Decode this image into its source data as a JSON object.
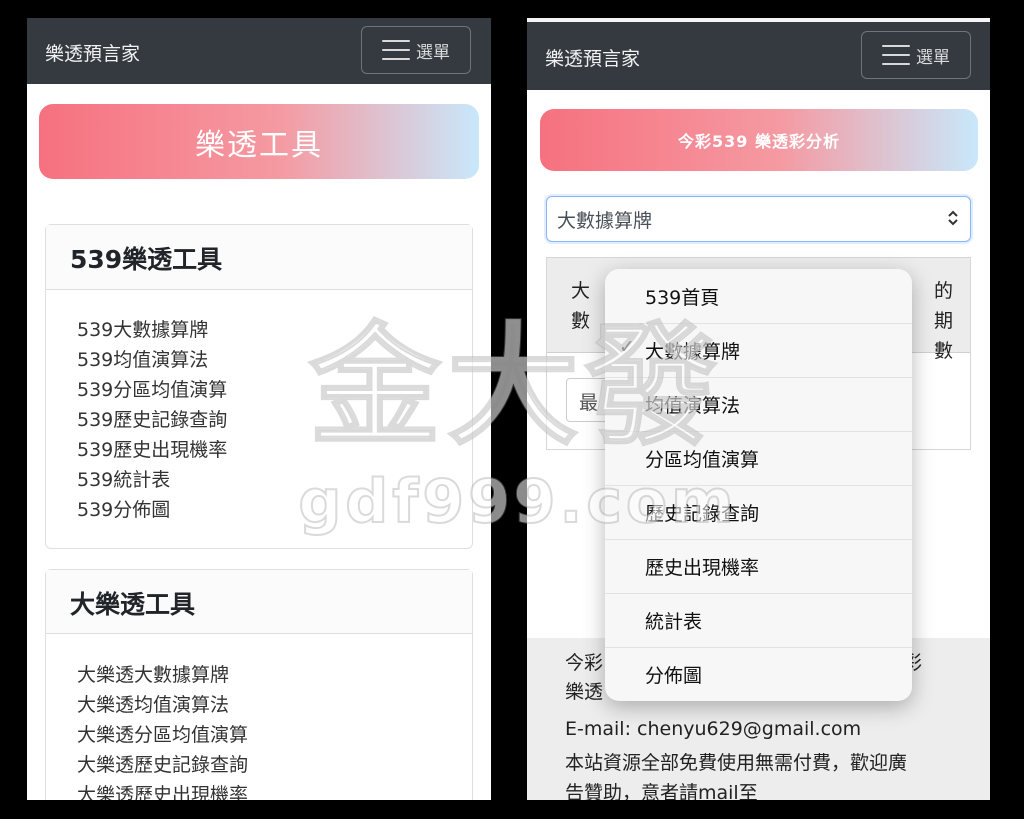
{
  "left": {
    "brand": "樂透預言家",
    "menu_label": "選單",
    "banner_title": "樂透工具",
    "card1": {
      "title": "539樂透工具",
      "links": [
        "539大數據算牌",
        "539均值演算法",
        "539分區均值演算",
        "539歷史記錄查詢",
        "539歷史出現機率",
        "539統計表",
        "539分佈圖"
      ]
    },
    "card2": {
      "title": "大樂透工具",
      "links": [
        "大樂透大數據算牌",
        "大樂透均值演算法",
        "大樂透分區均值演算",
        "大樂透歷史記錄查詢",
        "大樂透歷史出現機率"
      ]
    }
  },
  "right": {
    "brand": "樂透預言家",
    "menu_label": "選單",
    "banner_title": "今彩539 樂透彩分析",
    "select_value": "大數據算牌",
    "table": {
      "header_left": "大數",
      "header_right": "的期數",
      "input_text": "最"
    },
    "footer": {
      "line1": "今彩",
      "line1_tail": "彩",
      "line2": "樂透",
      "email": "E-mail: chenyu629@gmail.com",
      "line4": "本站資源全部免費使用無需付費，歡迎廣",
      "line5": "告贊助，意者請mail至"
    },
    "dropdown": {
      "items": [
        {
          "label": "539首頁",
          "checked": false
        },
        {
          "label": "大數據算牌",
          "checked": true
        },
        {
          "label": "均值演算法",
          "checked": false
        },
        {
          "label": "分區均值演算",
          "checked": false
        },
        {
          "label": "歷史記錄查詢",
          "checked": false
        },
        {
          "label": "歷史出現機率",
          "checked": false
        },
        {
          "label": "統計表",
          "checked": false
        },
        {
          "label": "分佈圖",
          "checked": false
        }
      ],
      "check_glyph": "✓"
    }
  },
  "watermark": {
    "main": "金大發",
    "sub": "gdf999.com"
  },
  "colors": {
    "navbar": "#343a40",
    "banner_start": "#f6717f",
    "banner_end": "#c8e8fb",
    "focus_border": "#86b7fe"
  }
}
